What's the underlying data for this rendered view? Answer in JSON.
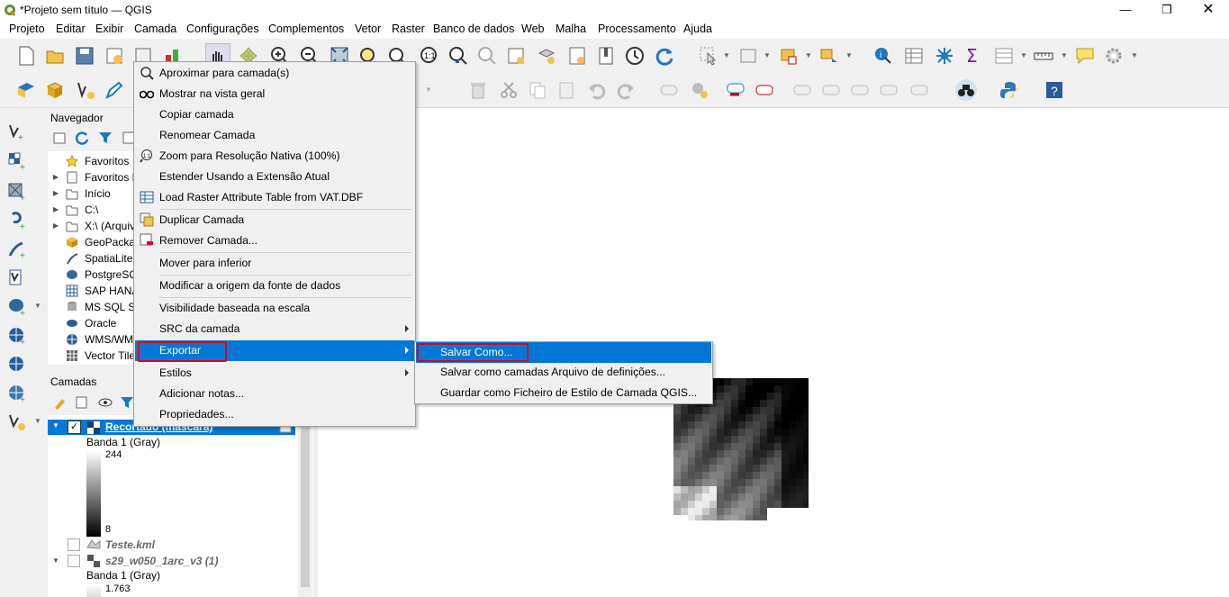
{
  "window": {
    "title": "*Projeto sem título — QGIS"
  },
  "menubar": {
    "items": [
      "Projeto",
      "Editar",
      "Exibir",
      "Camada",
      "Configurações",
      "Complementos",
      "Vetor",
      "Raster",
      "Banco de dados",
      "Web",
      "Malha",
      "Processamento",
      "Ajuda"
    ]
  },
  "browser": {
    "title": "Navegador",
    "items": [
      {
        "label": "Favoritos",
        "icon": "star-icon"
      },
      {
        "label": "Favoritos E",
        "icon": "bookmark-icon"
      },
      {
        "label": "Início",
        "icon": "folder-icon"
      },
      {
        "label": "C:\\",
        "icon": "folder-icon"
      },
      {
        "label": "X:\\ (Arquiv",
        "icon": "folder-icon"
      },
      {
        "label": "GeoPackag",
        "icon": "geopackage-icon"
      },
      {
        "label": "SpatiaLite",
        "icon": "feather-icon"
      },
      {
        "label": "PostgreSQ",
        "icon": "elephant-icon"
      },
      {
        "label": "SAP HANA",
        "icon": "grid-icon"
      },
      {
        "label": "MS SQL Se",
        "icon": "database-icon"
      },
      {
        "label": "Oracle",
        "icon": "oracle-icon"
      },
      {
        "label": "WMS/WM",
        "icon": "globe-icon"
      },
      {
        "label": "Vector Tile",
        "icon": "tiles-icon"
      }
    ]
  },
  "layers": {
    "title": "Camadas",
    "items": [
      {
        "name": "Recortado (máscara)",
        "band": "Banda 1 (Gray)",
        "max": "244",
        "min": "8"
      },
      {
        "name": "Teste.kml"
      },
      {
        "name": "s29_w050_1arc_v3 (1)",
        "band": "Banda 1 (Gray)",
        "max": "1.763"
      }
    ]
  },
  "context_menu": {
    "items": [
      {
        "label": "Aproximar para camada(s)",
        "icon": "zoom-layer-icon"
      },
      {
        "label": "Mostrar na vista geral",
        "icon": "glasses-icon"
      },
      {
        "label": "Copiar camada"
      },
      {
        "label": "Renomear Camada"
      },
      {
        "label": "Zoom para Resolução Nativa (100%)",
        "icon": "zoom-native-icon"
      },
      {
        "label": "Estender Usando a Extensão Atual"
      },
      {
        "label": "Load Raster Attribute Table from VAT.DBF",
        "icon": "table-icon"
      },
      {
        "label": "Duplicar Camada",
        "icon": "duplicate-icon"
      },
      {
        "label": "Remover Camada...",
        "icon": "remove-layer-icon"
      },
      {
        "label": "Mover para  inferior"
      },
      {
        "label": "Modificar a origem da fonte de dados"
      },
      {
        "label": "Visibilidade baseada na escala"
      },
      {
        "label": "SRC da camada"
      },
      {
        "label": "Exportar"
      },
      {
        "label": "Estilos"
      },
      {
        "label": "Adicionar notas..."
      },
      {
        "label": "Propriedades..."
      }
    ]
  },
  "export_submenu": {
    "items": [
      "Salvar Como...",
      "Salvar como camadas Arquivo de definições...",
      "Guardar como Ficheiro de Estilo de Camada QGIS..."
    ]
  },
  "colors": {
    "highlight": "#0078d7",
    "redbox": "#e0001b"
  }
}
